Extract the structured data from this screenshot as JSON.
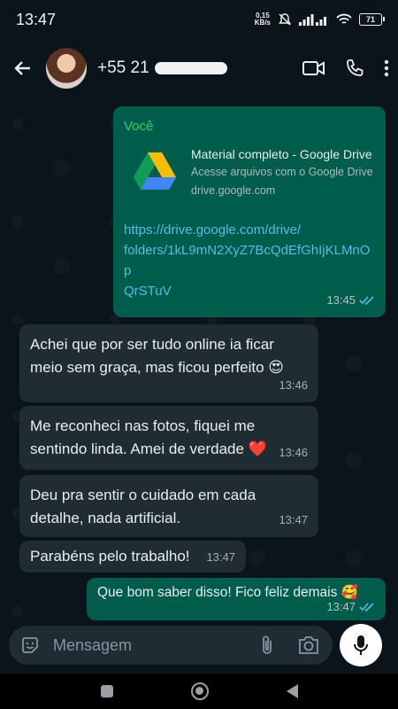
{
  "status_bar": {
    "time": "13:47",
    "net_speed_value": "0,15",
    "net_speed_unit": "KB/s",
    "battery": "71"
  },
  "header": {
    "contact_visible": "+55 21"
  },
  "messages": [
    {
      "direction": "outgoing",
      "sender": "Você",
      "card_title": "Material completo - Google Drive",
      "card_description": "Acesse arquivos com o Google Drive",
      "card_domain": "drive.google.com",
      "url_lines": [
        "https://drive.google.com/drive/",
        "folders/1kL9mN2XyZ7BcQdEfGhIjKLMnOp",
        "QrSTuV"
      ],
      "time": "13:45",
      "status": "read"
    },
    {
      "direction": "incoming",
      "lines": [
        "Achei que por ser tudo online ia ficar",
        "meio sem graça, mas ficou perfeito 😍"
      ],
      "time": "13:46"
    },
    {
      "direction": "incoming",
      "lines": [
        "Me reconheci nas fotos, fiquei me",
        "sentindo linda. Amei de verdade ❤️"
      ],
      "time": "13:46"
    },
    {
      "direction": "incoming",
      "lines": [
        "Deu pra sentir o cuidado em cada",
        "detalhe, nada artificial."
      ],
      "time": "13:47"
    },
    {
      "direction": "incoming",
      "lines": [
        "Parabéns pelo trabalho!"
      ],
      "time": "13:47"
    },
    {
      "direction": "outgoing",
      "lines": [
        "Que bom saber disso! Fico feliz demais 🥰"
      ],
      "time": "13:47",
      "status": "read"
    }
  ],
  "composer": {
    "placeholder": "Mensagem"
  },
  "colors": {
    "background": "#0b141a",
    "incoming_bubble": "#202c33",
    "outgoing_bubble": "#005c4b",
    "link": "#53bdeb",
    "sender_name": "#25d366",
    "read_ticks": "#53bdeb"
  },
  "icons": [
    "back-arrow-icon",
    "video-call-icon",
    "phone-icon",
    "more-vert-icon",
    "sticker-icon",
    "attach-icon",
    "camera-icon",
    "mic-icon",
    "google-drive-icon",
    "double-check-icon"
  ]
}
